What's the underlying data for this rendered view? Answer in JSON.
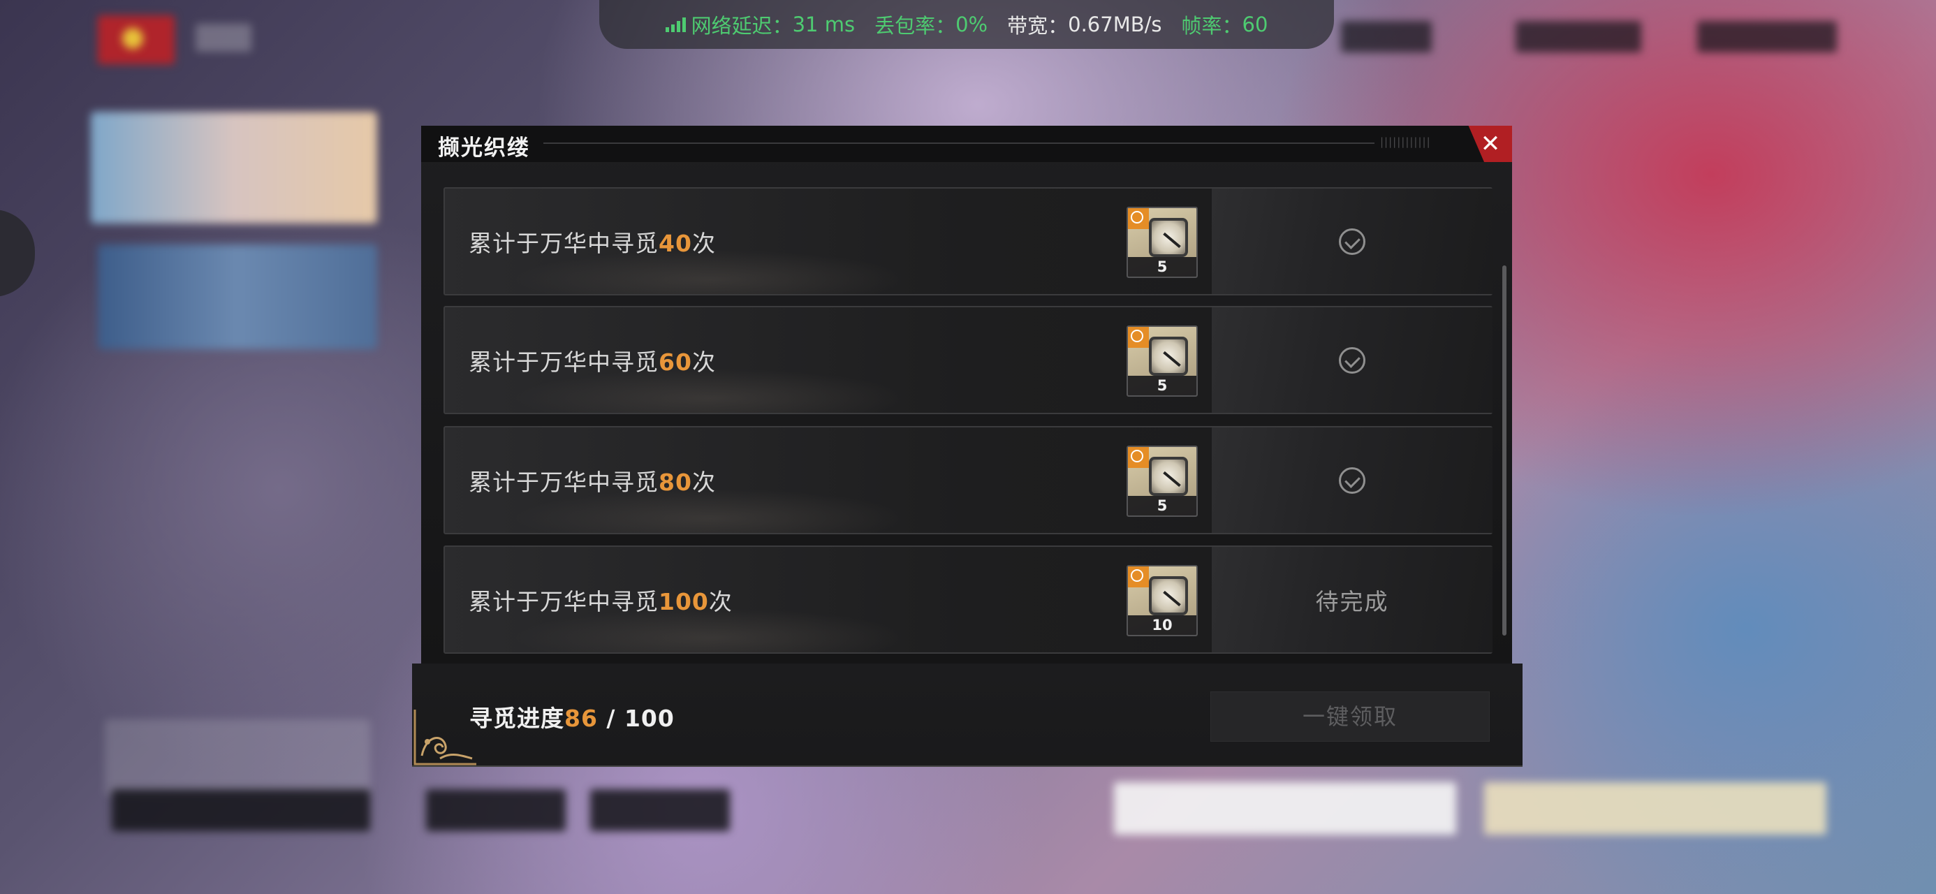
{
  "status_bar": {
    "latency_label": "网络延迟：",
    "latency_value": "31 ms",
    "loss_label": "丢包率：",
    "loss_value": "0%",
    "bandwidth_label": "带宽：",
    "bandwidth_value": "0.67MB/s",
    "fps_label": "帧率：",
    "fps_value": "60"
  },
  "modal": {
    "title": "撷光织缕",
    "close_icon": "close-icon"
  },
  "tasks": [
    {
      "text_prefix": "累计于万华中寻觅",
      "count": "40",
      "text_suffix": "次",
      "reward_qty": "5",
      "status": "completed",
      "status_icon": "check-circle-icon"
    },
    {
      "text_prefix": "累计于万华中寻觅",
      "count": "60",
      "text_suffix": "次",
      "reward_qty": "5",
      "status": "completed",
      "status_icon": "check-circle-icon"
    },
    {
      "text_prefix": "累计于万华中寻觅",
      "count": "80",
      "text_suffix": "次",
      "reward_qty": "5",
      "status": "completed",
      "status_icon": "check-circle-icon"
    },
    {
      "text_prefix": "累计于万华中寻觅",
      "count": "100",
      "text_suffix": "次",
      "reward_qty": "10",
      "status": "pending",
      "status_text": "待完成"
    }
  ],
  "footer": {
    "progress_label": "寻觅进度",
    "progress_current": "86",
    "progress_separator": " / ",
    "progress_total": "100",
    "claim_all_label": "一键领取"
  },
  "colors": {
    "accent_orange": "#e8963a",
    "close_red": "#b11f23",
    "status_green": "#4ecb71"
  }
}
